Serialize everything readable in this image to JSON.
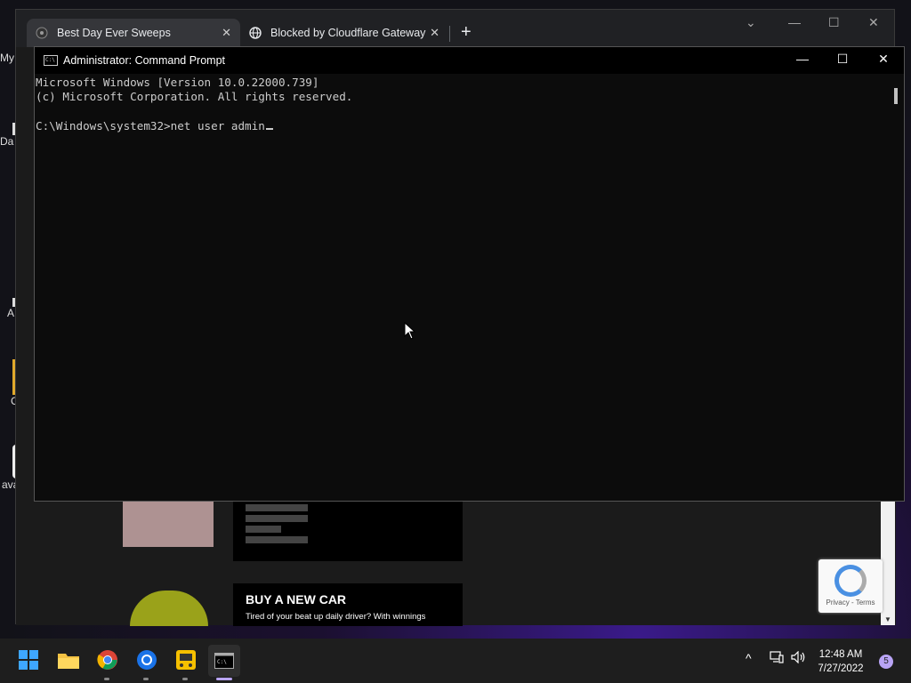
{
  "desktop": {
    "icon_labels": [
      "My",
      "Da",
      "A",
      "C",
      "ava"
    ]
  },
  "browser": {
    "tabs": [
      {
        "label": "Best Day Ever Sweeps",
        "icon": "sweeps-favicon"
      },
      {
        "label": "Blocked by Cloudflare Gateway",
        "icon": "globe-icon"
      }
    ],
    "new_tab": "+",
    "page": {
      "car_title": "BUY A NEW CAR",
      "car_subtitle": "Tired of your beat up daily driver? With winnings",
      "recaptcha_links": "Privacy - Terms"
    }
  },
  "cmd": {
    "title": "Administrator: Command Prompt",
    "lines": [
      "Microsoft Windows [Version 10.0.22000.739]",
      "(c) Microsoft Corporation. All rights reserved.",
      "",
      "C:\\Windows\\system32>net user admin"
    ],
    "buttons": {
      "minimize": "—",
      "maximize": "☐",
      "close": "✕"
    }
  },
  "taskbar": {
    "apps": [
      "start-icon",
      "file-explorer-icon",
      "chrome-icon",
      "chrome-beta-icon",
      "bus-app-icon",
      "terminal-icon"
    ],
    "tray": {
      "chevron": "^",
      "network": "⎘",
      "volume": "🔊"
    },
    "time": "12:48 AM",
    "date": "7/27/2022",
    "notifications": "5"
  },
  "colors": {
    "accent": "#b9a4f5",
    "cmd_bg": "#0c0c0c",
    "cmd_text": "#cccccc"
  }
}
